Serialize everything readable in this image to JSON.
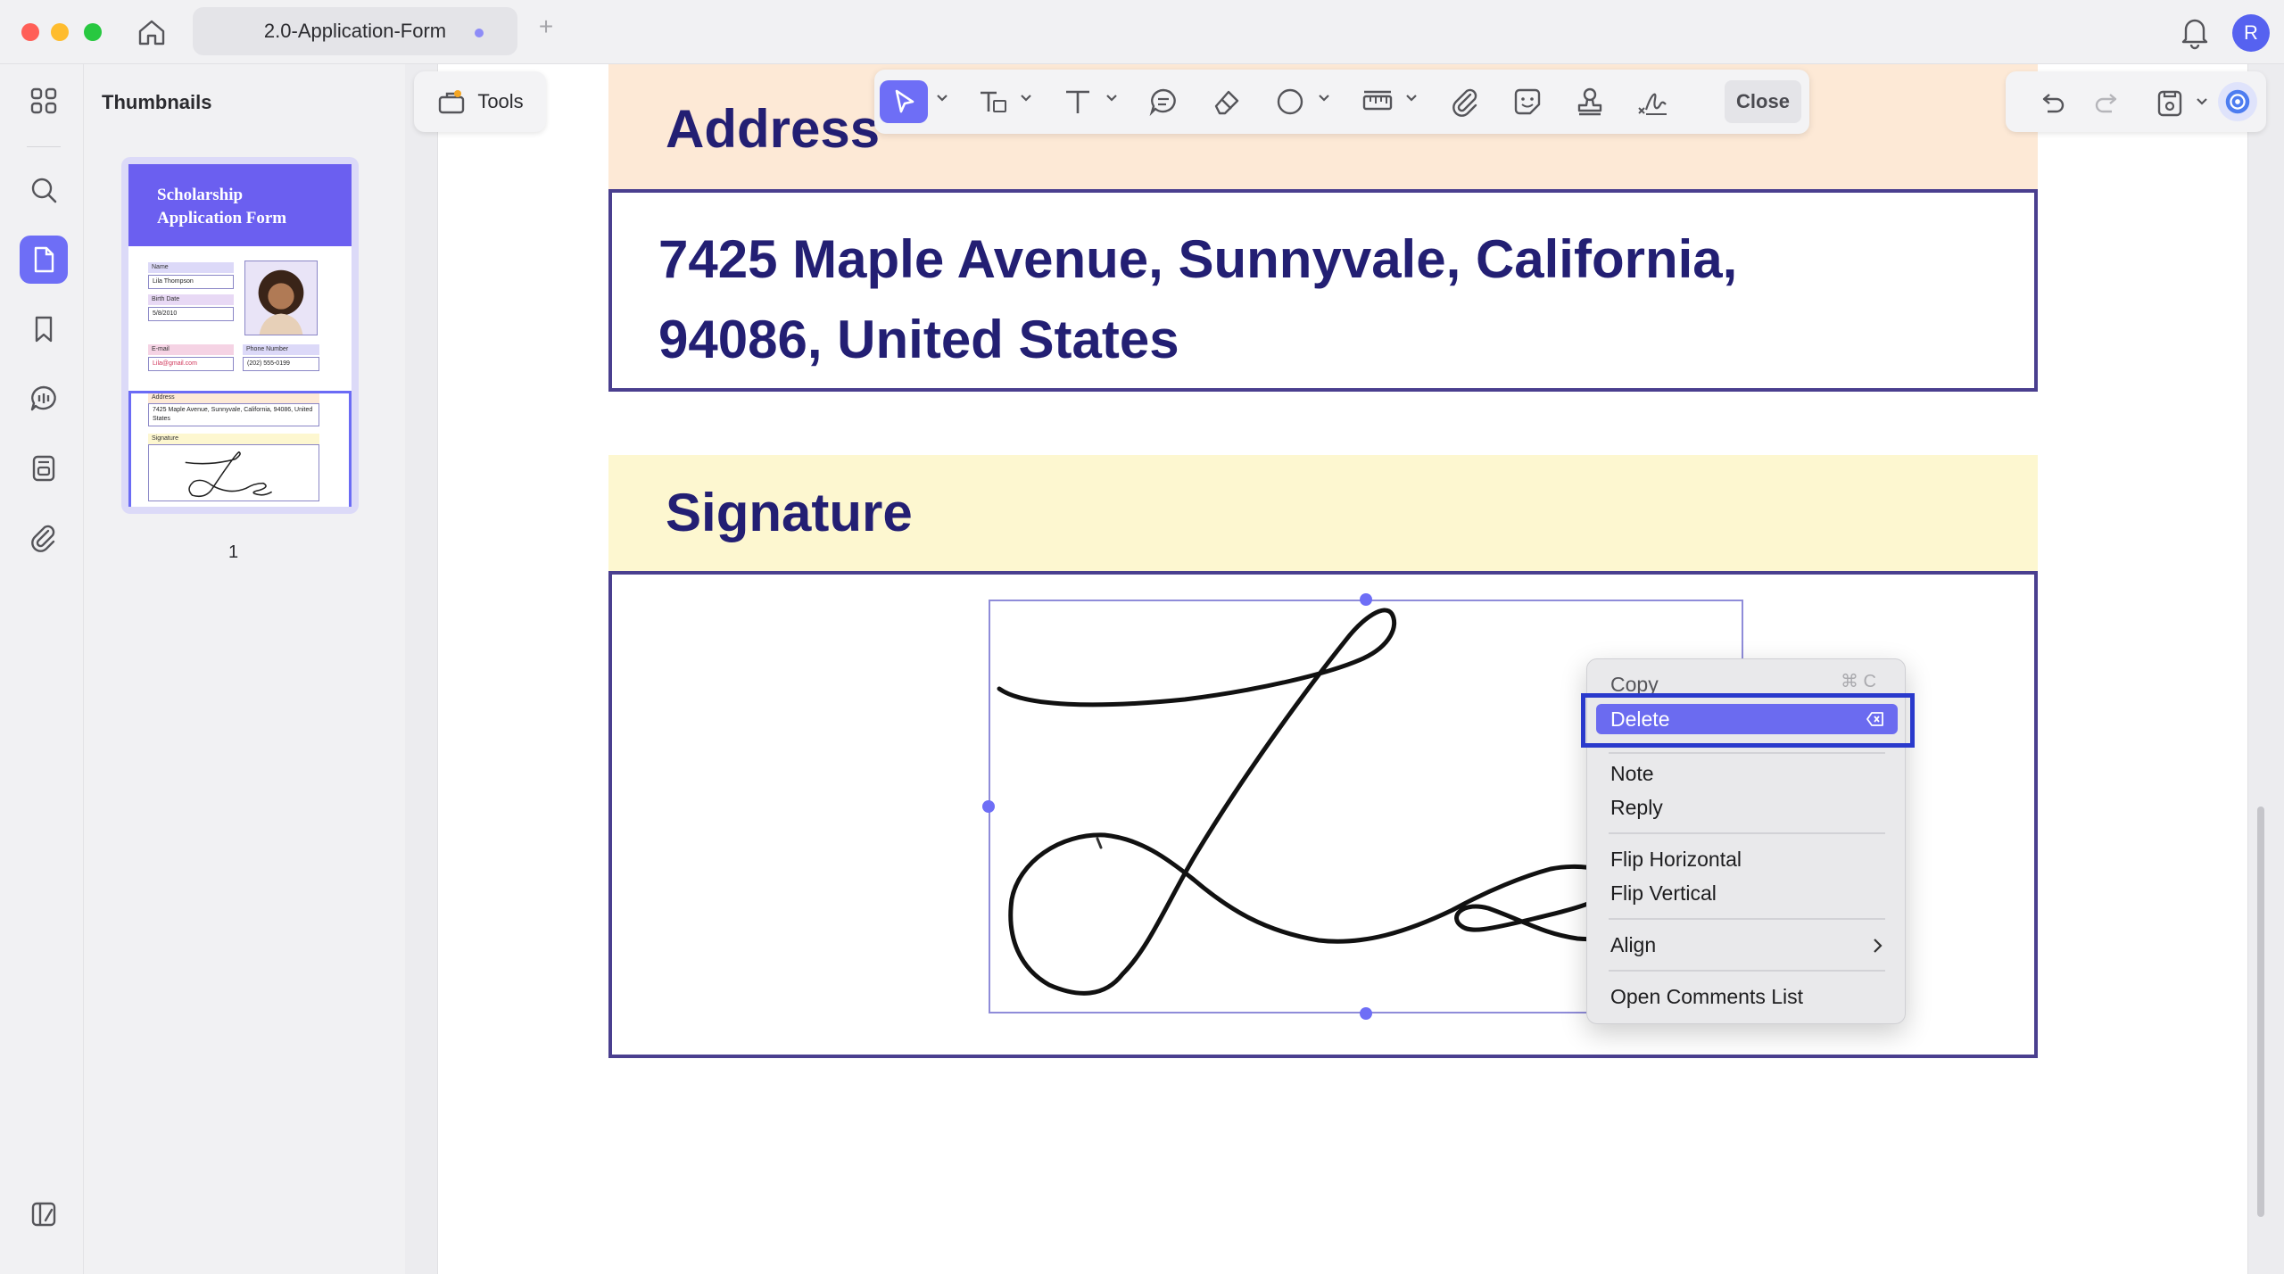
{
  "window": {
    "tab_title": "2.0-Application-Form",
    "new_tab_symbol": "+",
    "avatar_letter": "R"
  },
  "sidebar": {
    "panel_title": "Thumbnails",
    "rail_icons": [
      "grid-icon",
      "search-icon",
      "page-icon",
      "bookmark-icon",
      "comments-icon",
      "form-icon",
      "attachment-icon",
      "panel-toggle-icon"
    ],
    "active_icon": "page-icon"
  },
  "thumbnail": {
    "page_number": "1",
    "header_line1": "Scholarship",
    "header_line2": "Application Form",
    "labels": {
      "name": "Name",
      "name_value": "Lila Thompson",
      "birth": "Birth Date",
      "birth_value": "5/8/2010",
      "email": "E-mail",
      "email_value": "Lila@gmail.com",
      "phone": "Phone Number",
      "phone_value": "(202) 555-0199",
      "address": "Address",
      "address_value": "7425 Maple Avenue, Sunnyvale, California, 94086, United States",
      "signature": "Signature"
    }
  },
  "toolbar": {
    "tools_label": "Tools",
    "close_label": "Close",
    "tools": [
      "select-icon",
      "text-box-icon",
      "text-icon",
      "comment-icon",
      "eraser-icon",
      "shape-icon",
      "measure-icon",
      "attach-icon",
      "sticker-icon",
      "stamp-icon",
      "signature-icon"
    ],
    "active_tool": "select-icon"
  },
  "document": {
    "address_heading": "Address",
    "address_line1": "7425 Maple Avenue, Sunnyvale, California,",
    "address_line2": "94086, United States",
    "signature_heading": "Signature",
    "colors": {
      "heading_text": "#231f73",
      "address_band": "#fde9d6",
      "signature_band": "#fdf7d0",
      "box_border": "#4a3f8f",
      "accent": "#6e6ef6"
    }
  },
  "context_menu": {
    "items": {
      "copy": "Copy",
      "copy_shortcut": "⌘ C",
      "delete": "Delete",
      "note": "Note",
      "reply": "Reply",
      "flip_h": "Flip Horizontal",
      "flip_v": "Flip Vertical",
      "align": "Align",
      "open_comments": "Open Comments List"
    },
    "highlighted": "delete"
  }
}
